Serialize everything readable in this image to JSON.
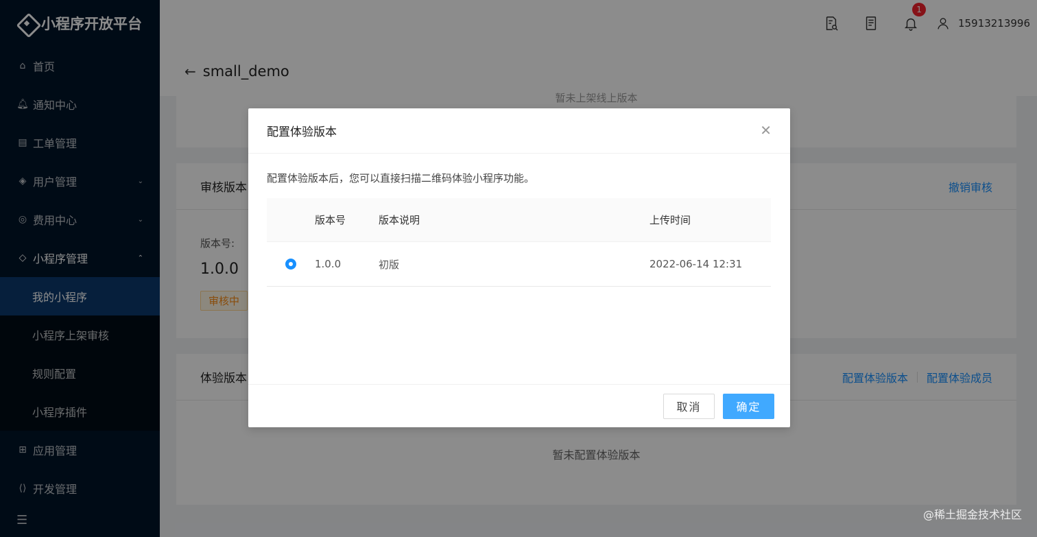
{
  "app": {
    "title": "小程序开放平台"
  },
  "sidebar": {
    "items": [
      {
        "label": "首页",
        "icon": "home-icon"
      },
      {
        "label": "通知中心",
        "icon": "bell-icon"
      },
      {
        "label": "工单管理",
        "icon": "clipboard-icon"
      },
      {
        "label": "用户管理",
        "icon": "layers-icon",
        "expandable": true
      },
      {
        "label": "费用中心",
        "icon": "coin-icon",
        "expandable": true
      },
      {
        "label": "小程序管理",
        "icon": "diamond-icon",
        "expanded": true
      }
    ],
    "submenu": [
      {
        "label": "我的小程序",
        "selected": true
      },
      {
        "label": "小程序上架审核"
      },
      {
        "label": "规则配置"
      },
      {
        "label": "小程序插件"
      }
    ],
    "bottom_items": [
      {
        "label": "应用管理",
        "icon": "grid-icon"
      },
      {
        "label": "开发管理",
        "icon": "code-icon"
      }
    ]
  },
  "header": {
    "notification_count": "1",
    "username": "15913213996"
  },
  "page": {
    "title": "small_demo",
    "online_empty": "暂未上架线上版本",
    "review": {
      "title": "审核版本",
      "action": "撤销审核",
      "version_label": "版本号:",
      "version_value": "1.0.0",
      "status": "审核中"
    },
    "trial": {
      "title": "体验版本",
      "action_config": "配置体验版本",
      "action_members": "配置体验成员",
      "empty": "暂未配置体验版本"
    }
  },
  "modal": {
    "title": "配置体验版本",
    "description": "配置体验版本后，您可以直接扫描二维码体验小程序功能。",
    "columns": [
      "版本号",
      "版本说明",
      "上传时间"
    ],
    "rows": [
      {
        "version": "1.0.0",
        "note": "初版",
        "time": "2022-06-14 12:31",
        "selected": true
      }
    ],
    "cancel_label": "取消",
    "ok_label": "确定"
  },
  "watermark": "@稀土掘金技术社区",
  "colors": {
    "primary": "#1890ff",
    "sidebar_bg": "#001529",
    "selected_bg": "#0b3a6e"
  }
}
